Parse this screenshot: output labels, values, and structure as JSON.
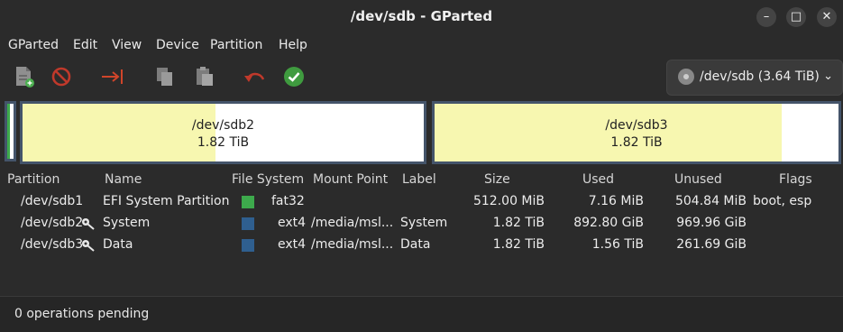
{
  "window": {
    "title": "/dev/sdb - GParted"
  },
  "menubar": {
    "items": [
      "GParted",
      "Edit",
      "View",
      "Device",
      "Partition",
      "Help"
    ]
  },
  "toolbar": {
    "buttons": [
      {
        "icon": "new-partition-icon"
      },
      {
        "icon": "delete-icon"
      },
      {
        "icon": "resize-move-icon"
      },
      {
        "icon": "copy-icon"
      },
      {
        "icon": "paste-icon"
      },
      {
        "icon": "undo-icon"
      },
      {
        "icon": "apply-icon"
      }
    ],
    "device": "/dev/sdb (3.64 TiB)"
  },
  "diskmap": {
    "partitions": [
      {
        "name": "/dev/sdb2",
        "size": "1.82 TiB",
        "used_fraction": 0.48
      },
      {
        "name": "/dev/sdb3",
        "size": "1.82 TiB",
        "used_fraction": 0.86
      }
    ]
  },
  "table": {
    "columns": [
      "Partition",
      "Name",
      "File System",
      "Mount Point",
      "Label",
      "Size",
      "Used",
      "Unused",
      "Flags"
    ],
    "rows": [
      {
        "partition": "/dev/sdb1",
        "name": "EFI System Partition",
        "fs": "fat32",
        "fs_color": "#3daa4c",
        "mount": "",
        "label": "",
        "size": "512.00 MiB",
        "used": "7.16 MiB",
        "unused": "504.84 MiB",
        "flags": "boot, esp",
        "mounted": false
      },
      {
        "partition": "/dev/sdb2",
        "name": "System",
        "fs": "ext4",
        "fs_color": "#2f5f8f",
        "mount": "/media/msl...",
        "label": "System",
        "size": "1.82 TiB",
        "used": "892.80 GiB",
        "unused": "969.96 GiB",
        "flags": "",
        "mounted": true
      },
      {
        "partition": "/dev/sdb3",
        "name": "Data",
        "fs": "ext4",
        "fs_color": "#2f5f8f",
        "mount": "/media/msl...",
        "label": "Data",
        "size": "1.82 TiB",
        "used": "1.56 TiB",
        "unused": "261.69 GiB",
        "flags": "",
        "mounted": true
      }
    ]
  },
  "status": {
    "text": "0 operations pending"
  }
}
